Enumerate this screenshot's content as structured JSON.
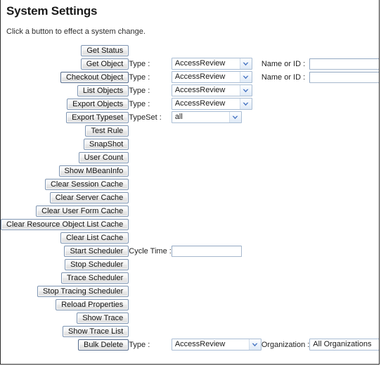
{
  "page": {
    "title": "System Settings",
    "intro": "Click a button to effect a system change."
  },
  "labels": {
    "type": "Type :",
    "typeset": "TypeSet :",
    "name_or_id": "Name or ID :",
    "cycle_time": "Cycle Time :",
    "organization": "Organization :"
  },
  "values": {
    "type_default": "AccessReview",
    "typeset_default": "all",
    "organization_default": "All Organizations",
    "name_or_id_value": "",
    "cycle_time_value": ""
  },
  "icons": {
    "dropdown": "chevron-down-icon"
  },
  "colors": {
    "button_border": "#7c93b0",
    "select_border": "#a9bdd4",
    "input_border": "#a7b8cd",
    "arrow_blue": "#4a77c4",
    "page_border": "#2b2b2b"
  },
  "rows": [
    {
      "id": "get-status",
      "button": "Get Status",
      "controls": []
    },
    {
      "id": "get-object",
      "button": "Get Object",
      "controls": [
        "type-select",
        "name-or-id"
      ]
    },
    {
      "id": "checkout-object",
      "button": "Checkout Object",
      "controls": [
        "type-select",
        "name-or-id"
      ]
    },
    {
      "id": "list-objects",
      "button": "List Objects",
      "controls": [
        "type-select"
      ]
    },
    {
      "id": "export-objects",
      "button": "Export Objects",
      "controls": [
        "type-select"
      ]
    },
    {
      "id": "export-typeset",
      "button": "Export Typeset",
      "controls": [
        "typeset-select"
      ]
    },
    {
      "id": "test-rule",
      "button": "Test Rule",
      "controls": []
    },
    {
      "id": "snapshot",
      "button": "SnapShot",
      "controls": []
    },
    {
      "id": "user-count",
      "button": "User Count",
      "controls": []
    },
    {
      "id": "show-mbeaninfo",
      "button": "Show MBeanInfo",
      "controls": []
    },
    {
      "id": "clear-session-cache",
      "button": "Clear Session Cache",
      "controls": []
    },
    {
      "id": "clear-server-cache",
      "button": "Clear Server Cache",
      "controls": []
    },
    {
      "id": "clear-user-form-cache",
      "button": "Clear User Form Cache",
      "controls": []
    },
    {
      "id": "clear-resource-object-list-cache",
      "button": "Clear Resource Object List Cache",
      "controls": []
    },
    {
      "id": "clear-list-cache",
      "button": "Clear List Cache",
      "controls": []
    },
    {
      "id": "start-scheduler",
      "button": "Start Scheduler",
      "controls": [
        "cycle-time"
      ]
    },
    {
      "id": "stop-scheduler",
      "button": "Stop Scheduler",
      "controls": []
    },
    {
      "id": "trace-scheduler",
      "button": "Trace Scheduler",
      "controls": []
    },
    {
      "id": "stop-tracing-scheduler",
      "button": "Stop Tracing Scheduler",
      "controls": []
    },
    {
      "id": "reload-properties",
      "button": "Reload Properties",
      "controls": []
    },
    {
      "id": "show-trace",
      "button": "Show Trace",
      "controls": []
    },
    {
      "id": "show-trace-list",
      "button": "Show Trace List",
      "controls": []
    },
    {
      "id": "bulk-delete",
      "button": "Bulk Delete",
      "controls": [
        "type-select-lg",
        "organization-select"
      ]
    }
  ]
}
